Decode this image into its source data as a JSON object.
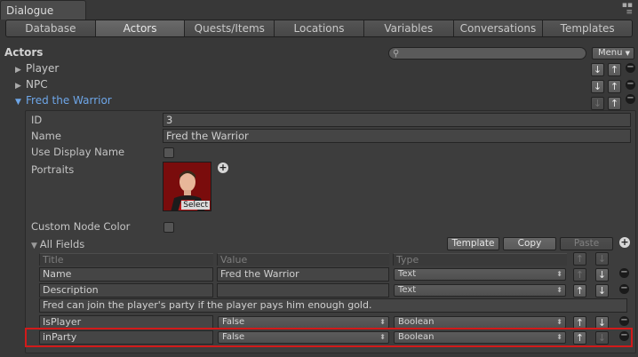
{
  "window": {
    "tab_label": "Dialogue"
  },
  "tabs": [
    {
      "label": "Database"
    },
    {
      "label": "Actors"
    },
    {
      "label": "Quests/Items"
    },
    {
      "label": "Locations"
    },
    {
      "label": "Variables"
    },
    {
      "label": "Conversations"
    },
    {
      "label": "Templates"
    }
  ],
  "active_tab": "Actors",
  "section_title": "Actors",
  "menu_button": "Menu",
  "actors": [
    {
      "name": "Player"
    },
    {
      "name": "NPC"
    },
    {
      "name": "Fred the Warrior"
    }
  ],
  "fields": {
    "id_label": "ID",
    "id_value": "3",
    "name_label": "Name",
    "name_value": "Fred the Warrior",
    "use_display_name_label": "Use Display Name",
    "portraits_label": "Portraits",
    "portrait_select": "Select",
    "custom_node_color_label": "Custom Node Color",
    "all_fields_label": "All Fields"
  },
  "buttons": {
    "template": "Template",
    "copy": "Copy",
    "paste": "Paste"
  },
  "columns": {
    "title": "Title",
    "value": "Value",
    "type": "Type"
  },
  "rows": [
    {
      "title": "Name",
      "value": "Fred the Warrior",
      "type": "Text"
    },
    {
      "title": "Description",
      "value": "",
      "type": "Text",
      "description": "Fred can join the player's party if the player pays him enough gold."
    },
    {
      "title": "IsPlayer",
      "value": "False",
      "type": "Boolean"
    },
    {
      "title": "inParty",
      "value": "False",
      "type": "Boolean"
    }
  ],
  "colors": {
    "accent_blue": "#6ea6e8",
    "highlight_red": "#d21a1a"
  }
}
